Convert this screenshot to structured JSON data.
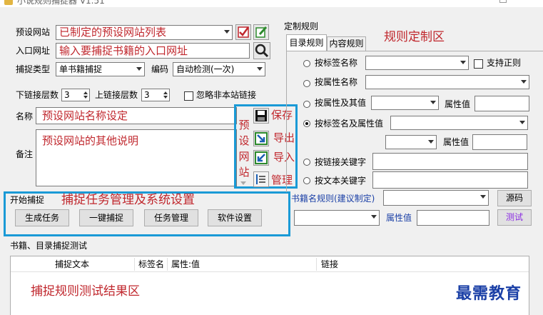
{
  "window": {
    "title": "小说规则捕捉器 V1.51"
  },
  "left": {
    "preset_site": {
      "label": "预设网站",
      "value": "已制定的预设网站列表"
    },
    "entry_url": {
      "label": "入口网址",
      "value": "输入要捕捉书籍的入口网址"
    },
    "capture_type": {
      "label": "捕捉类型",
      "value": "单书籍捕捉"
    },
    "encoding": {
      "label": "编码",
      "value": "自动检测(一次)"
    },
    "lower_levels": {
      "label": "下链接层数",
      "value": "3"
    },
    "upper_levels": {
      "label": "上链接层数",
      "value": "3"
    },
    "ignore_external": {
      "label": "忽略非本站链接"
    },
    "name": {
      "label": "名称",
      "value": "预设网站名称设定"
    },
    "note": {
      "label": "备注",
      "value": "预设网站的其他说明"
    }
  },
  "preset_panel": {
    "vertical_chars": [
      "预",
      "设",
      "网",
      "站"
    ],
    "save": "保存",
    "export": "导出",
    "import": "导入",
    "manage": "管理"
  },
  "start": {
    "title": "开始捕捉",
    "annotation": "捕捉任务管理及系统设置",
    "buttons": [
      "生成任务",
      "一键捕捉",
      "任务管理",
      "软件设置"
    ]
  },
  "rules": {
    "title": "定制规则",
    "tabs": [
      "目录规则",
      "内容规则"
    ],
    "annotation": "规则定制区",
    "by_tag": "按标签名称",
    "regex": "支持正则",
    "by_attr_name": "按属性名称",
    "by_attr_value": "按属性及其值",
    "attr_value": "属性值",
    "by_tag_attr": "按标签名及属性值",
    "by_link_keyword": "按链接关键字",
    "by_text_keyword": "按文本关键字",
    "bookname_rule": "书籍名规则(建议制定)",
    "source_btn": "源码",
    "test_btn": "测试"
  },
  "results": {
    "title": "书籍、目录捕捉测试",
    "columns": [
      "捕捉文本",
      "标签名",
      "属性:值",
      "链接"
    ],
    "annotation": "捕捉规则测试结果区",
    "watermark": "最需教育"
  },
  "colors": {
    "accent": "#1a9ad6",
    "annotation": "#c0272d"
  }
}
